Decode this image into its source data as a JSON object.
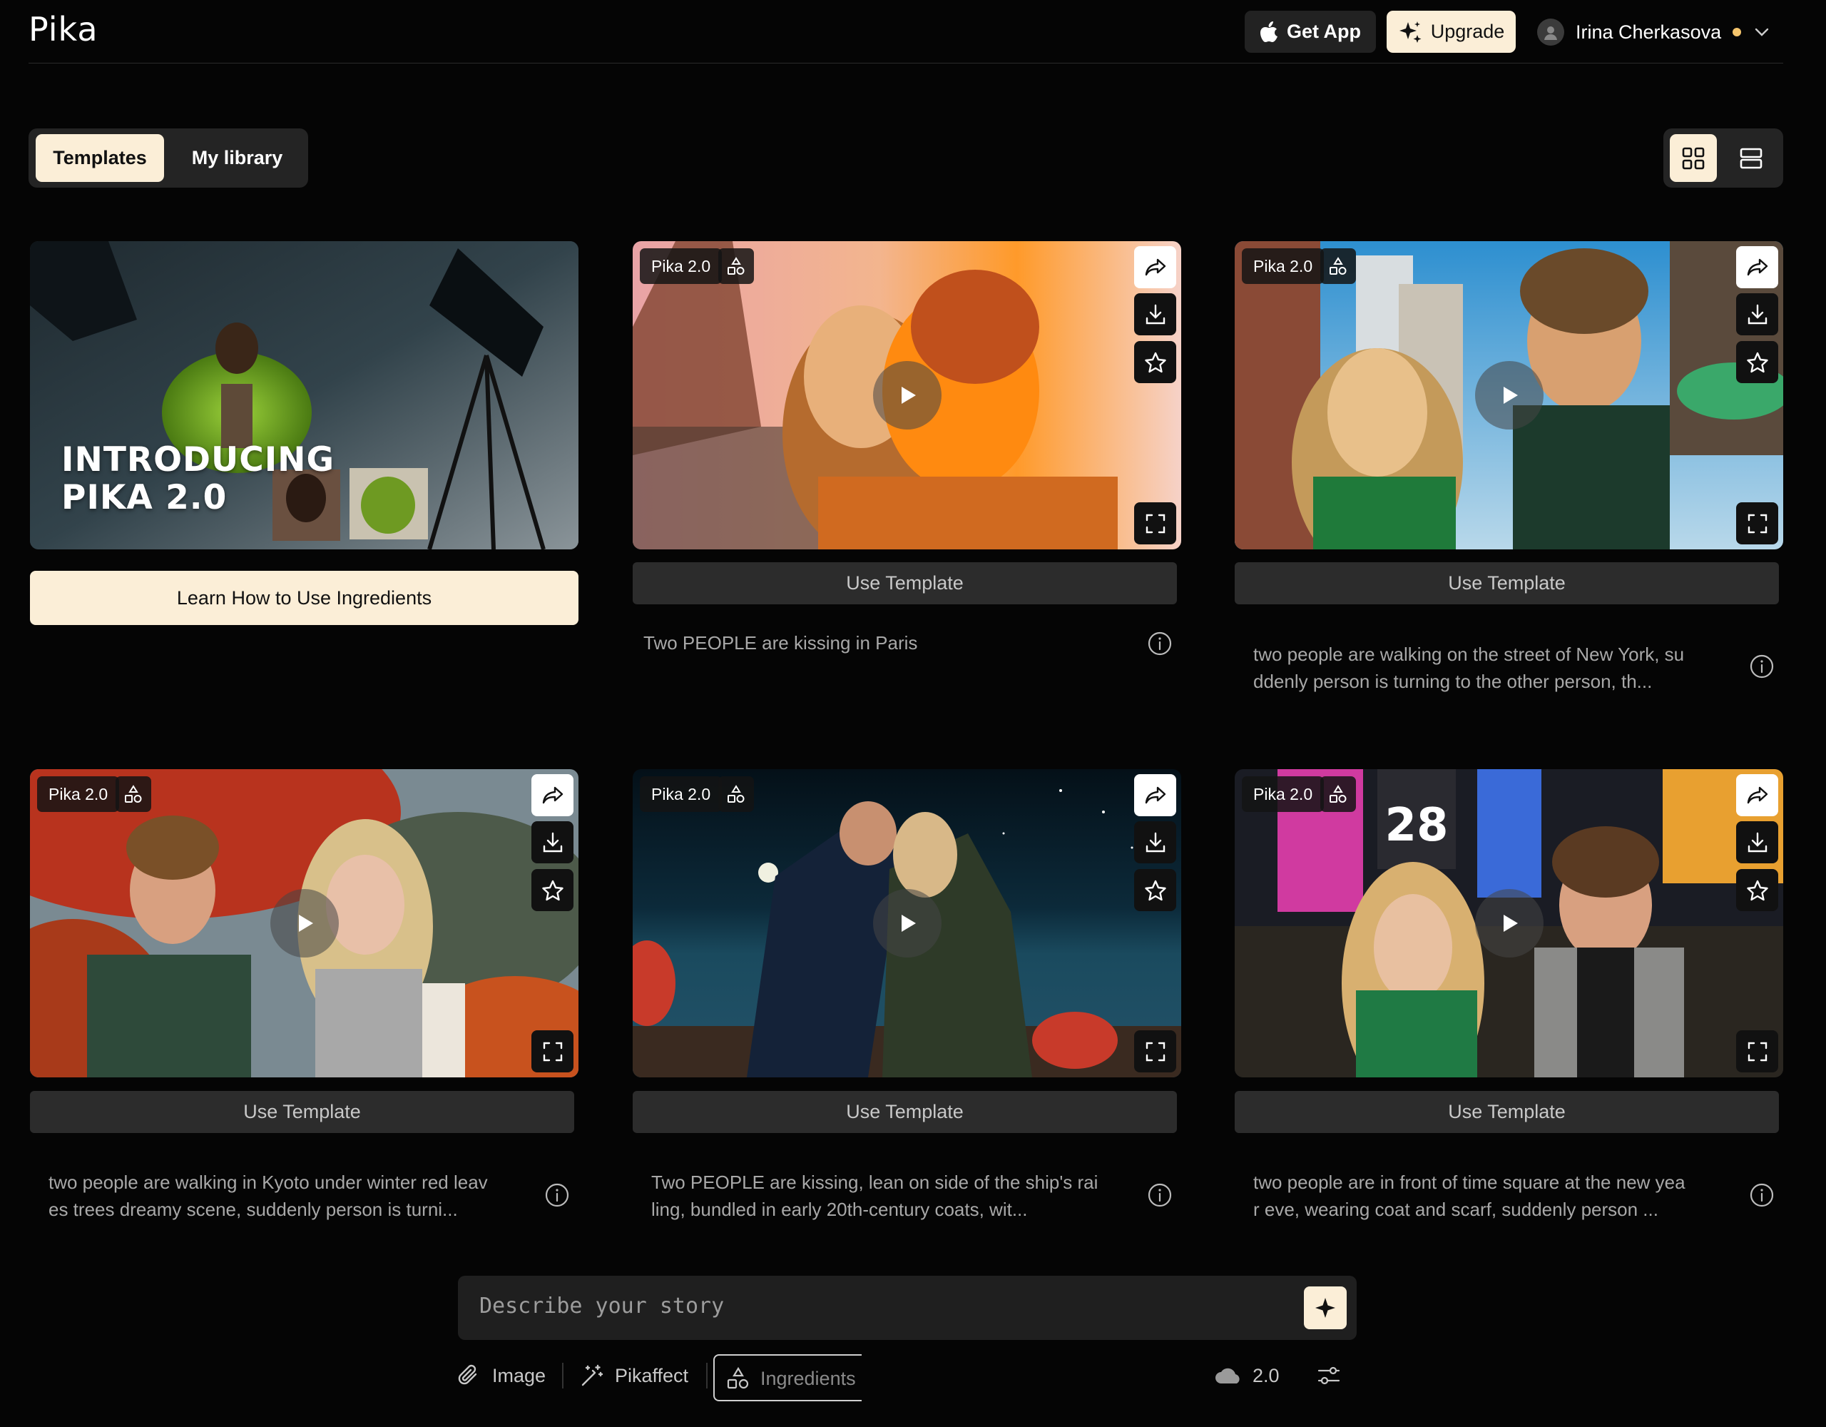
{
  "header": {
    "logo": "Pika",
    "get_app_label": "Get App",
    "upgrade_label": "Upgrade",
    "user_name": "Irina Cherkasova"
  },
  "tabs": [
    {
      "label": "Templates",
      "active": true
    },
    {
      "label": "My library",
      "active": false
    }
  ],
  "view_modes": [
    "grid-icon",
    "list-icon"
  ],
  "intro_card": {
    "title_line1": "INTRODUCING",
    "title_line2": "PIKA 2.0",
    "button_label": "Learn How to Use Ingredients"
  },
  "templates": [
    {
      "badge": "Pika 2.0",
      "button": "Use Template",
      "description": "Two PEOPLE are kissing in Paris"
    },
    {
      "badge": "Pika 2.0",
      "button": "Use Template",
      "description_lines": [
        "two people are walking on the street of New York, su",
        "ddenly person is turning to the other person, th..."
      ]
    },
    {
      "badge": "Pika 2.0",
      "button": "Use Template",
      "description_lines": [
        "two people are walking in Kyoto under winter red leav",
        "es trees dreamy scene, suddenly person is turni..."
      ]
    },
    {
      "badge": "Pika 2.0",
      "button": "Use Template",
      "description_lines": [
        "Two PEOPLE are kissing, lean on side of the ship's rai",
        "ling, bundled in early 20th-century coats, wit..."
      ]
    },
    {
      "badge": "Pika 2.0",
      "button": "Use Template",
      "description_lines": [
        "two people are in front of time square at the new yea",
        "r eve, wearing coat and scarf, suddenly person ..."
      ]
    }
  ],
  "scene_text": {
    "times_square_sign": "28"
  },
  "prompt": {
    "placeholder": "Describe your story",
    "tools": [
      {
        "label": "Image",
        "icon": "paperclip-icon"
      },
      {
        "label": "Pikaffect",
        "icon": "magic-wand-icon"
      },
      {
        "label": "Ingredients",
        "icon": "shapes-icon"
      }
    ],
    "model_version": "2.0"
  },
  "colors": {
    "accent": "#fbeed7",
    "background": "#050505",
    "status_dot": "#f5c56c"
  }
}
